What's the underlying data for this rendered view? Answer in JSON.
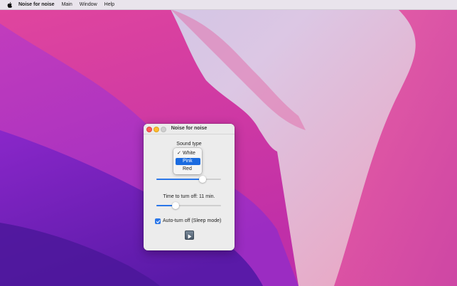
{
  "menubar": {
    "apple_icon": "apple-logo-icon",
    "app_name": "Noise for noise",
    "items": [
      "Main",
      "Window",
      "Help"
    ]
  },
  "window": {
    "title": "Noise for noise",
    "sound_type_label": "Sound type",
    "sound_options": [
      {
        "label": "White",
        "checked": true,
        "highlighted": false
      },
      {
        "label": "Pink",
        "checked": false,
        "highlighted": true
      },
      {
        "label": "Red",
        "checked": false,
        "highlighted": false
      }
    ],
    "volume_slider_value": 0.71,
    "timer_label": "Time to turn off: 11 min.",
    "timer_slider_value": 0.3,
    "auto_turn_off_label": "Auto-turn off (Sleep mode)",
    "auto_turn_off_checked": true,
    "play_icon": "play-icon"
  },
  "colors": {
    "accent": "#2a76e8",
    "selection": "#1a6be0"
  }
}
